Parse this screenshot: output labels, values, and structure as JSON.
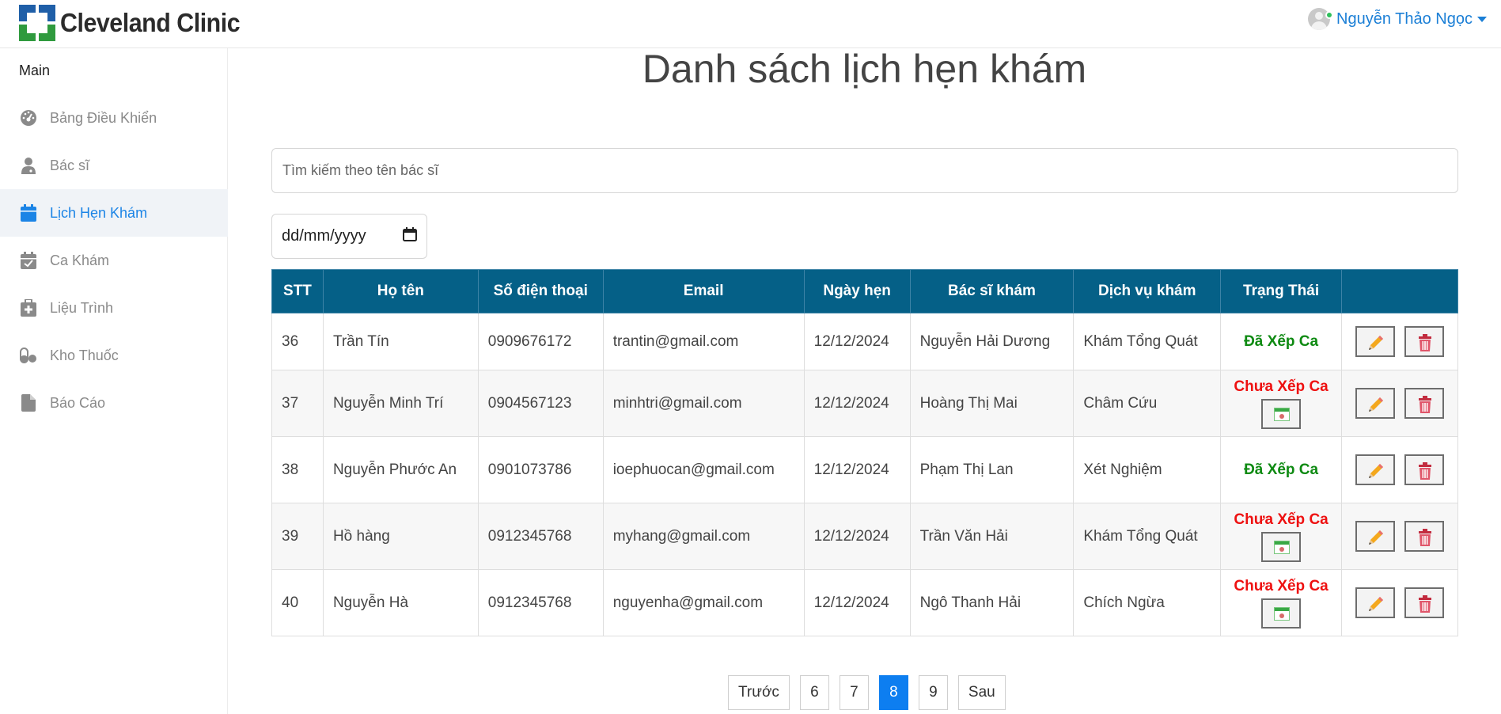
{
  "app": {
    "brand": "Cleveland Clinic"
  },
  "user": {
    "name": "Nguyễn Thảo Ngọc"
  },
  "sidebar": {
    "section": "Main",
    "items": [
      {
        "label": "Bảng Điều Khiển",
        "icon": "dashboard-gauge-icon"
      },
      {
        "label": "Bác sĩ",
        "icon": "doctor-icon"
      },
      {
        "label": "Lịch Hẹn Khám",
        "icon": "calendar-icon",
        "active": true
      },
      {
        "label": "Ca Khám",
        "icon": "calendar-check-icon"
      },
      {
        "label": "Liệu Trình",
        "icon": "medical-kit-icon"
      },
      {
        "label": "Kho Thuốc",
        "icon": "pills-icon"
      },
      {
        "label": "Báo Cáo",
        "icon": "file-icon"
      }
    ]
  },
  "main": {
    "title": "Danh sách lịch hẹn khám",
    "search_placeholder": "Tìm kiếm theo tên bác sĩ",
    "date_placeholder": "dd/mm/yyyy"
  },
  "table": {
    "headers": [
      "STT",
      "Họ tên",
      "Số điện thoại",
      "Email",
      "Ngày hẹn",
      "Bác sĩ khám",
      "Dịch vụ khám",
      "Trạng Thái",
      ""
    ],
    "rows": [
      {
        "stt": "36",
        "name": "Trần Tín",
        "phone": "0909676172",
        "email": "trantin@gmail.com",
        "date": "12/12/2024",
        "doctor": "Nguyễn Hải Dương",
        "service": "Khám Tổng Quát",
        "status": "Đã Xếp Ca",
        "scheduled": true
      },
      {
        "stt": "37",
        "name": "Nguyễn Minh Trí",
        "phone": "0904567123",
        "email": "minhtri@gmail.com",
        "date": "12/12/2024",
        "doctor": "Hoàng Thị Mai",
        "service": "Châm Cứu",
        "status": "Chưa Xếp Ca",
        "scheduled": false
      },
      {
        "stt": "38",
        "name": "Nguyễn Phước An",
        "phone": "0901073786",
        "email": "ioephuocan@gmail.com",
        "date": "12/12/2024",
        "doctor": "Phạm Thị Lan",
        "service": "Xét Nghiệm",
        "status": "Đã Xếp Ca",
        "scheduled": true
      },
      {
        "stt": "39",
        "name": "Hồ hàng",
        "phone": "0912345768",
        "email": "myhang@gmail.com",
        "date": "12/12/2024",
        "doctor": "Trần Văn Hải",
        "service": "Khám Tổng Quát",
        "status": "Chưa Xếp Ca",
        "scheduled": false
      },
      {
        "stt": "40",
        "name": "Nguyễn Hà",
        "phone": "0912345768",
        "email": "nguyenha@gmail.com",
        "date": "12/12/2024",
        "doctor": "Ngô Thanh Hải",
        "service": "Chích Ngừa",
        "status": "Chưa Xếp Ca",
        "scheduled": false
      }
    ]
  },
  "pagination": {
    "prev": "Trước",
    "pages": [
      "6",
      "7",
      "8",
      "9"
    ],
    "current": "8",
    "next": "Sau"
  },
  "colors": {
    "header_bg": "#056087",
    "accent": "#1b84e6",
    "status_ok": "#0e8a12",
    "status_pending": "#ee1111",
    "page_active": "#0d7ef0"
  }
}
